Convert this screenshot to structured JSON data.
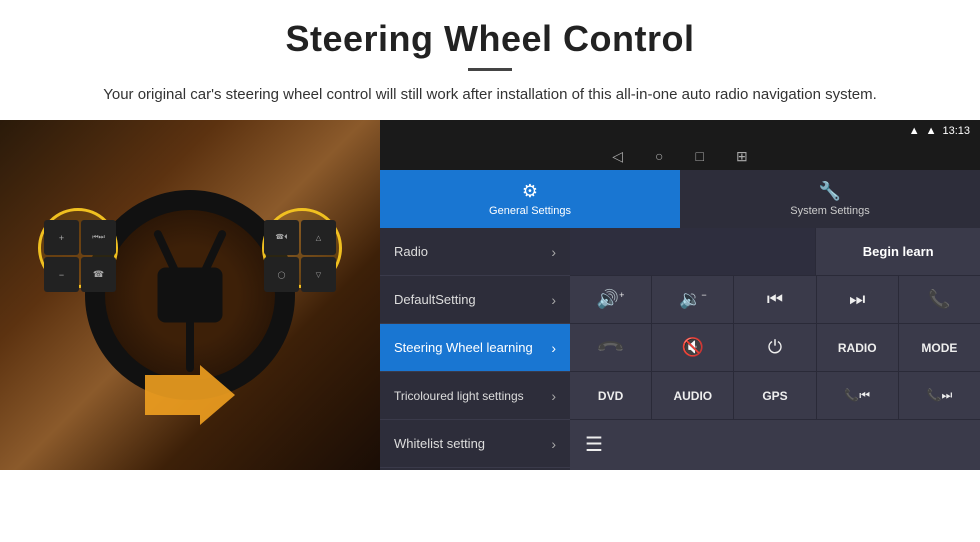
{
  "header": {
    "title": "Steering Wheel Control",
    "subtitle": "Your original car's steering wheel control will still work after installation of this all-in-one auto radio navigation system.",
    "divider": true
  },
  "statusBar": {
    "time": "13:13",
    "icons": [
      "signal",
      "wifi",
      "battery"
    ]
  },
  "navBar": {
    "items": [
      "◁",
      "○",
      "□",
      "⊞"
    ]
  },
  "tabs": [
    {
      "id": "general",
      "label": "General Settings",
      "icon": "⚙",
      "active": true
    },
    {
      "id": "system",
      "label": "System Settings",
      "icon": "🔧",
      "active": false
    }
  ],
  "menu": {
    "items": [
      {
        "id": "radio",
        "label": "Radio",
        "active": false
      },
      {
        "id": "default-setting",
        "label": "DefaultSetting",
        "active": false
      },
      {
        "id": "steering-wheel",
        "label": "Steering Wheel learning",
        "active": true
      },
      {
        "id": "tricoloured",
        "label": "Tricoloured light settings",
        "active": false
      },
      {
        "id": "whitelist",
        "label": "Whitelist setting",
        "active": false
      }
    ]
  },
  "controls": {
    "beginLearnLabel": "Begin learn",
    "row1": [
      {
        "id": "vol-up",
        "label": "🔊+",
        "type": "icon"
      },
      {
        "id": "vol-down",
        "label": "🔉−",
        "type": "icon"
      },
      {
        "id": "prev",
        "label": "⏮",
        "type": "icon"
      },
      {
        "id": "next",
        "label": "⏭",
        "type": "icon"
      },
      {
        "id": "call",
        "label": "📞",
        "type": "icon"
      }
    ],
    "row2": [
      {
        "id": "hang",
        "label": "↩",
        "type": "icon"
      },
      {
        "id": "mute",
        "label": "🔇×",
        "type": "icon"
      },
      {
        "id": "power",
        "label": "⏻",
        "type": "icon"
      },
      {
        "id": "radio-btn",
        "label": "RADIO",
        "type": "text"
      },
      {
        "id": "mode-btn",
        "label": "MODE",
        "type": "text"
      }
    ],
    "row3": [
      {
        "id": "dvd-btn",
        "label": "DVD",
        "type": "text"
      },
      {
        "id": "audio-btn",
        "label": "AUDIO",
        "type": "text"
      },
      {
        "id": "gps-btn",
        "label": "GPS",
        "type": "text"
      },
      {
        "id": "call-prev",
        "label": "📞⏮",
        "type": "icon"
      },
      {
        "id": "call-next",
        "label": "📞⏭",
        "type": "icon"
      }
    ],
    "row4": [
      {
        "id": "list-icon",
        "label": "≡",
        "type": "icon"
      }
    ]
  }
}
